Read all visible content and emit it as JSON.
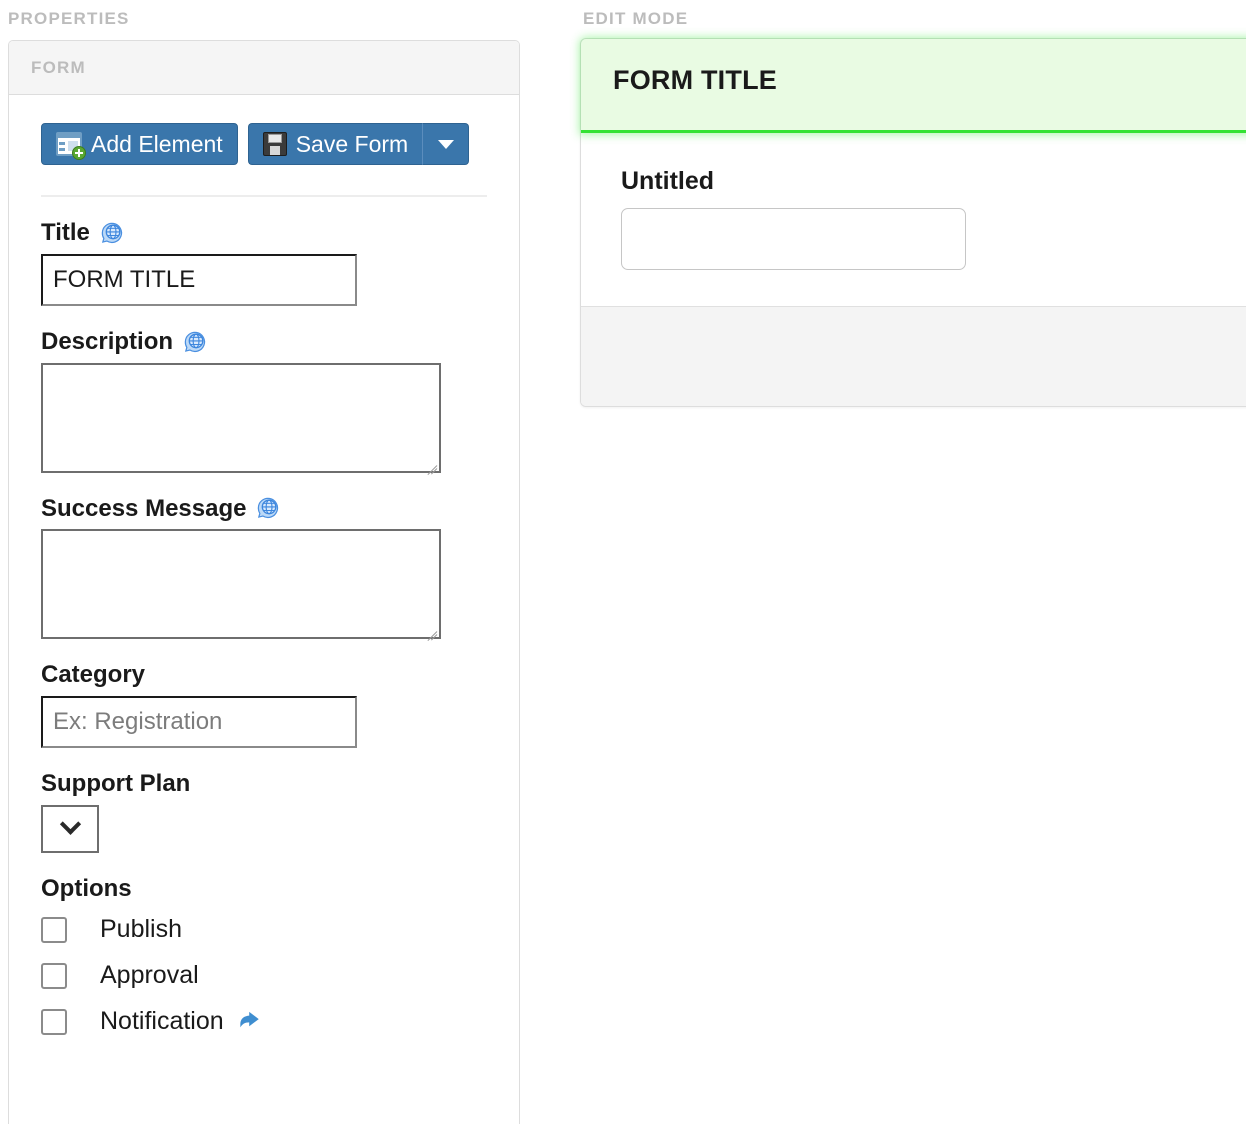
{
  "sections": {
    "properties_caption": "PROPERTIES",
    "editmode_caption": "EDIT MODE"
  },
  "properties_panel": {
    "header_title": "FORM",
    "toolbar": {
      "add_element_label": "Add Element",
      "add_element_icon": "add-element-icon",
      "save_form_label": "Save Form",
      "save_form_icon": "floppy-disk-icon",
      "dropdown_icon": "caret-down-icon",
      "button_color": "#3a76ab"
    },
    "fields": {
      "title": {
        "label": "Title",
        "translate_icon": "globe-translate-icon",
        "value": "FORM TITLE",
        "placeholder": ""
      },
      "description": {
        "label": "Description",
        "translate_icon": "globe-translate-icon",
        "value": "",
        "placeholder": ""
      },
      "success_message": {
        "label": "Success Message",
        "translate_icon": "globe-translate-icon",
        "value": "",
        "placeholder": ""
      },
      "category": {
        "label": "Category",
        "value": "",
        "placeholder": "Ex: Registration"
      },
      "support_plan": {
        "label": "Support Plan",
        "selected": "",
        "options": [],
        "chevron_icon": "chevron-down-icon"
      }
    },
    "options": {
      "title": "Options",
      "items": [
        {
          "label": "Publish",
          "checked": false
        },
        {
          "label": "Approval",
          "checked": false
        },
        {
          "label": "Notification",
          "checked": false,
          "link_icon": "external-link-icon"
        }
      ]
    }
  },
  "edit_panel": {
    "form_title": "FORM TITLE",
    "highlight_color": "#34e234",
    "highlight_background": "#e9fbe3",
    "elements": [
      {
        "label": "Untitled",
        "value": "",
        "placeholder": ""
      }
    ]
  }
}
